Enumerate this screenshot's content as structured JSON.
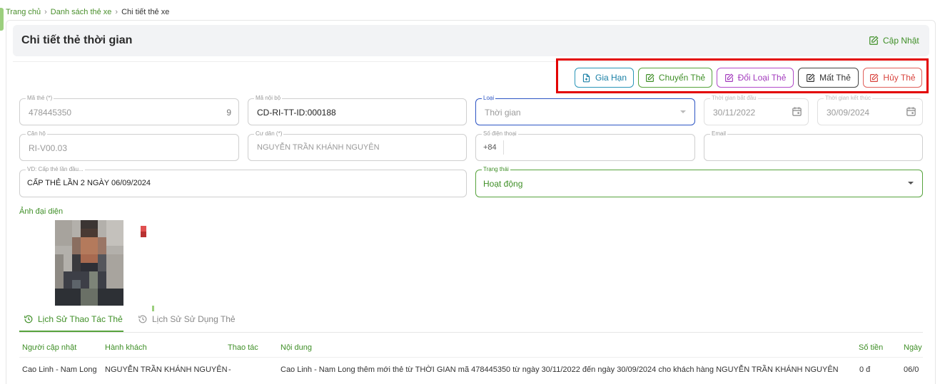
{
  "breadcrumb": {
    "home": "Trang chủ",
    "list": "Danh sách thẻ xe",
    "current": "Chi tiết thẻ xe"
  },
  "page": {
    "title": "Chi tiết thẻ thời gian",
    "update_label": "Cập Nhật"
  },
  "actions": {
    "renew": "Gia Hạn",
    "transfer": "Chuyển Thẻ",
    "change_type": "Đổi Loại Thẻ",
    "lost": "Mất Thẻ",
    "cancel": "Hủy Thẻ"
  },
  "form": {
    "card_code": {
      "label": "Mã thẻ (*)",
      "value": "478445350",
      "suffix": "9"
    },
    "internal_code": {
      "label": "Mã nội bộ",
      "value": "CD-RI-TT-ID:000188"
    },
    "type": {
      "label": "Loại",
      "value": "Thời gian"
    },
    "start_time": {
      "label": "Thời gian bắt đầu",
      "value": "30/11/2022"
    },
    "end_time": {
      "label": "Thời gian kết thúc",
      "value": "30/09/2024"
    },
    "apartment": {
      "label": "Căn hộ",
      "value": "RI-V00.03"
    },
    "resident": {
      "label": "Cư dân (*)",
      "value": "NGUYỄN TRẦN KHÁNH NGUYÊN"
    },
    "phone": {
      "label": "Số điện thoại",
      "prefix": "+84",
      "value": ""
    },
    "email": {
      "label": "Email",
      "value": ""
    },
    "note": {
      "label": "VD: Cấp thẻ lần đầu...",
      "value": "CẤP THẺ LẦN 2 NGÀY 06/09/2024"
    },
    "status": {
      "label": "Trạng thái",
      "value": "Hoạt động"
    }
  },
  "avatar": {
    "label": "Ảnh đại diện"
  },
  "tabs": {
    "history": "Lịch Sử Thao Tác Thẻ",
    "usage": "Lịch Sử Sử Dụng Thẻ"
  },
  "table": {
    "headers": {
      "updater": "Người cập nhật",
      "passenger": "Hành khách",
      "action": "Thao tác",
      "content": "Nội dung",
      "amount": "Số tiền",
      "date": "Ngày"
    },
    "rows": [
      {
        "updater": "Cao Linh - Nam Long",
        "passenger": "NGUYỄN TRẦN KHÁNH NGUYÊN",
        "action": "-",
        "content": "Cao Linh - Nam Long thêm mới thẻ từ THỜI GIAN mã 478445350 từ ngày 30/11/2022 đến ngày 30/09/2024 cho khách hàng NGUYỄN TRẦN KHÁNH NGUYÊN",
        "amount": "0 đ",
        "date": "06/0"
      }
    ]
  },
  "colors": {
    "brand_green": "#3f8f27",
    "highlight_red": "#e30000",
    "renew_blue": "#1b80a6",
    "change_purple": "#a33bbd",
    "cancel_red": "#d9443e"
  }
}
